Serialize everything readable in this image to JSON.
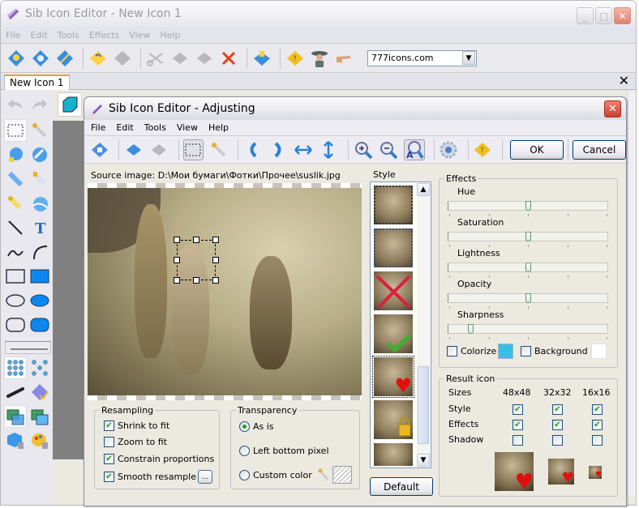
{
  "main_window": {
    "title": "Sib Icon Editor - New Icon 1",
    "menu": [
      "File",
      "Edit",
      "Tools",
      "Effects",
      "View",
      "Help"
    ],
    "toolbar_icons": [
      "new-icon",
      "new-from-image",
      "new-magic",
      "open-icon",
      "save-disabled",
      "cut-icon",
      "copy-icon",
      "paste-icon",
      "delete-icon",
      "export-icon",
      "help-book-icon",
      "cowboy-icon",
      "pointing-hand-icon"
    ],
    "url_combo": {
      "value": "777icons.com"
    },
    "doc_tab": "New Icon 1",
    "tab_close": "✕",
    "tools": [
      "undo",
      "redo",
      "rect-select",
      "eyedropper",
      "fill-bucket",
      "eraser",
      "pencil",
      "spray",
      "brush",
      "paint-drop",
      "line",
      "text",
      "curve",
      "arc",
      "rectangle",
      "filled-rectangle",
      "ellipse",
      "filled-ellipse",
      "rounded-rect",
      "filled-rounded-rect",
      "line-width",
      "grid-dots",
      "scatter-dots",
      "airbrush",
      "apply-effect",
      "layer-overlap",
      "layer-separate",
      "cube-locked",
      "palette-locked"
    ]
  },
  "dialog": {
    "title": "Sib Icon Editor - Adjusting",
    "menu": [
      "File",
      "Edit",
      "Tools",
      "View",
      "Help"
    ],
    "ok_label": "OK",
    "cancel_label": "Cancel",
    "source_label": "Source image: D:\\Мои бумаги\\Фотки\\Прочее\\suslik.jpg",
    "style_label": "Style",
    "style_items": [
      "stamp-border",
      "dotted-border",
      "red-cross",
      "green-check",
      "heart",
      "lock",
      "plain"
    ],
    "selected_style_index": 4,
    "default_label": "Default",
    "resampling": {
      "title": "Resampling",
      "options": [
        {
          "label": "Shrink to fit",
          "checked": true
        },
        {
          "label": "Zoom to fit",
          "checked": false
        },
        {
          "label": "Constrain proportions",
          "checked": true
        },
        {
          "label": "Smooth resample",
          "checked": true
        }
      ],
      "more_button": "..."
    },
    "transparency": {
      "title": "Transparency",
      "options": [
        {
          "label": "As is",
          "selected": true
        },
        {
          "label": "Left bottom pixel",
          "selected": false
        },
        {
          "label": "Custom color",
          "selected": false
        }
      ]
    },
    "effects": {
      "title": "Effects",
      "sliders": [
        {
          "label": "Hue",
          "value": 0.5
        },
        {
          "label": "Saturation",
          "value": 0.5
        },
        {
          "label": "Lightness",
          "value": 0.5
        },
        {
          "label": "Opacity",
          "value": 0.5
        },
        {
          "label": "Sharpness",
          "value": 0.14
        }
      ],
      "colorize_label": "Colorize",
      "colorize_checked": false,
      "colorize_color": "#35c0e8",
      "background_label": "Background",
      "background_checked": false,
      "background_color": "#ffffff"
    },
    "result": {
      "title": "Result icon",
      "sizes_label": "Sizes",
      "sizes": [
        "48x48",
        "32x32",
        "16x16"
      ],
      "rows": [
        {
          "label": "Style",
          "checks": [
            true,
            true,
            true
          ]
        },
        {
          "label": "Effects",
          "checks": [
            true,
            true,
            true
          ]
        },
        {
          "label": "Shadow",
          "checks": [
            false,
            false,
            false
          ]
        }
      ]
    }
  }
}
